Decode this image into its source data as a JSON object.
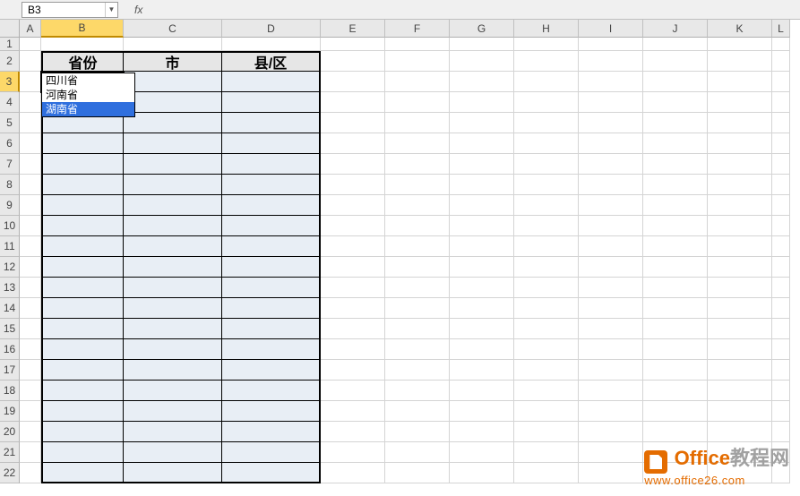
{
  "name_box": "B3",
  "fx_label": "fx",
  "formula_value": "",
  "columns": [
    "A",
    "B",
    "C",
    "D",
    "E",
    "F",
    "G",
    "H",
    "I",
    "J",
    "K",
    "L"
  ],
  "selected_column": "B",
  "row_numbers": [
    1,
    2,
    3,
    4,
    5,
    6,
    7,
    8,
    9,
    10,
    11,
    12,
    13,
    14,
    15,
    16,
    17,
    18,
    19,
    20,
    21,
    22
  ],
  "selected_row": 3,
  "table": {
    "headers": [
      "省份",
      "市",
      "县/区"
    ],
    "first_row": 2,
    "last_row": 22
  },
  "dropdown": {
    "items": [
      "四川省",
      "河南省",
      "湖南省"
    ],
    "highlighted_index": 2
  },
  "watermark": {
    "prefix": "Office",
    "suffix": "教程网",
    "url": "www.office26.com"
  }
}
